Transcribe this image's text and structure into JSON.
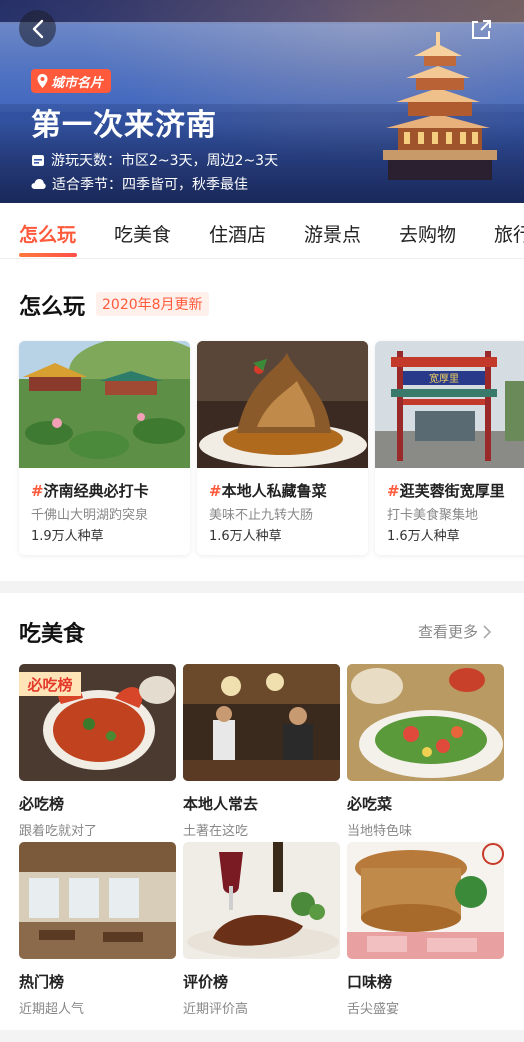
{
  "hero": {
    "badge": "城市名片",
    "title": "第一次来济南",
    "days_label": "游玩天数：市区2~3天，周边2~3天",
    "season_label": "适合季节：四季皆可，秋季最佳"
  },
  "tabs": [
    "怎么玩",
    "吃美食",
    "住酒店",
    "游景点",
    "去购物",
    "旅行"
  ],
  "play": {
    "title": "怎么玩",
    "update": "2020年8月更新",
    "cards": [
      {
        "title": "济南经典必打卡",
        "sub": "千佛山大明湖趵突泉",
        "count": "1.9万人种草"
      },
      {
        "title": "本地人私藏鲁菜",
        "sub": "美味不止九转大肠",
        "count": "1.6万人种草"
      },
      {
        "title": "逛芙蓉街宽厚里",
        "sub": "打卡美食聚集地",
        "count": "1.6万人种草"
      }
    ],
    "hash": "#"
  },
  "food": {
    "title": "吃美食",
    "more": "查看更多",
    "stamp": "必吃榜",
    "gate_sign": "宽厚里",
    "tiles": [
      {
        "name": "必吃榜",
        "desc": "跟着吃就对了"
      },
      {
        "name": "本地人常去",
        "desc": "土著在这吃"
      },
      {
        "name": "必吃菜",
        "desc": "当地特色味"
      },
      {
        "name": "热门榜",
        "desc": "近期超人气"
      },
      {
        "name": "评价榜",
        "desc": "近期评价高"
      },
      {
        "name": "口味榜",
        "desc": "舌尖盛宴"
      }
    ]
  },
  "colors": {
    "accent": "#ff5a3c",
    "text": "#222222",
    "muted": "#888888"
  }
}
